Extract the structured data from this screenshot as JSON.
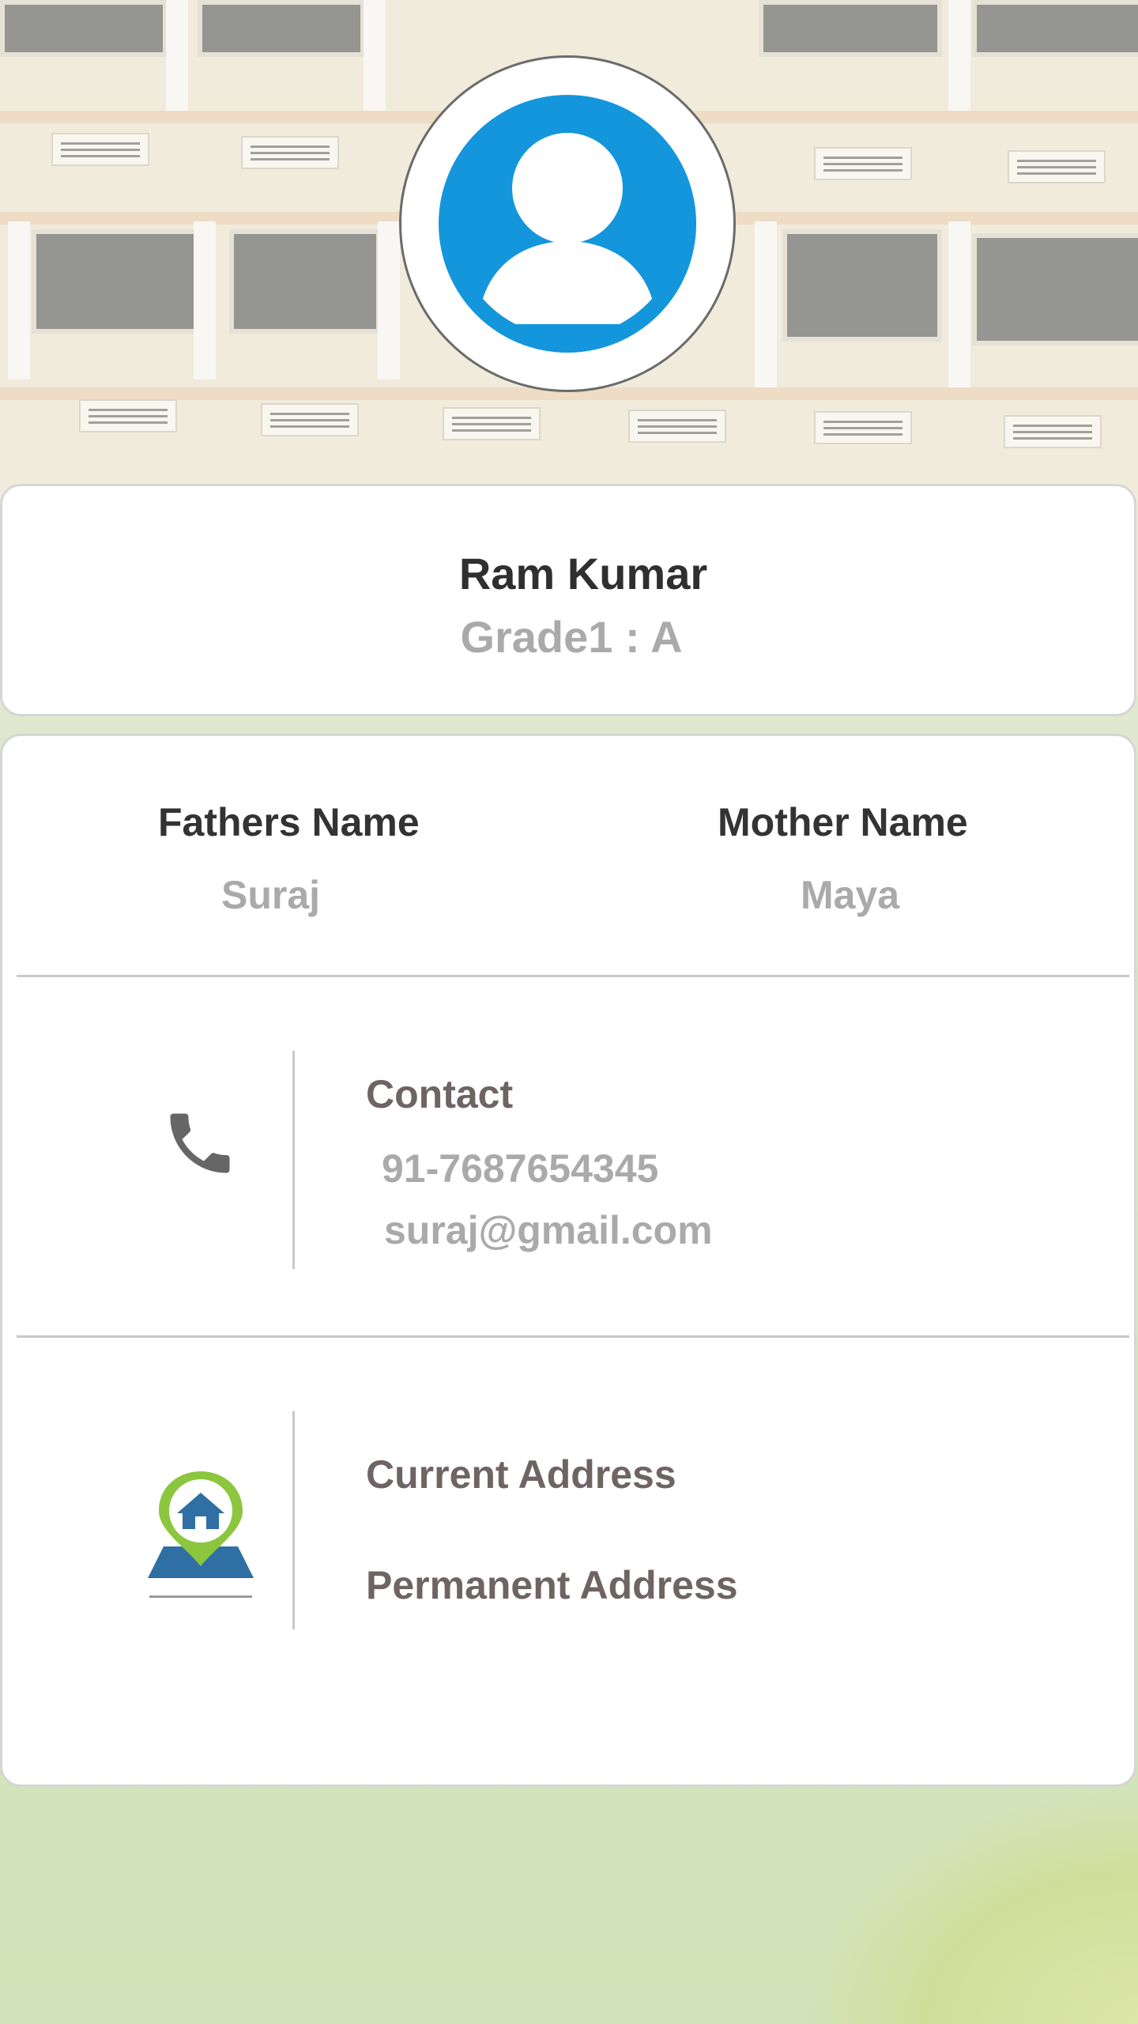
{
  "student": {
    "name": "Ram Kumar",
    "grade": "Grade1 : A"
  },
  "parents": {
    "father_label": "Fathers Name",
    "father_value": "Suraj",
    "mother_label": "Mother Name",
    "mother_value": "Maya"
  },
  "contact": {
    "label": "Contact",
    "phone": "91-7687654345",
    "email": "suraj@gmail.com",
    "icon": "phone-icon"
  },
  "address": {
    "current_label": "Current Address",
    "permanent_label": "Permanent Address",
    "icon": "home-location-icon"
  },
  "colors": {
    "avatar_blue": "#1396dc",
    "location_green": "#8cc63f",
    "location_blue": "#2f6fa3"
  }
}
